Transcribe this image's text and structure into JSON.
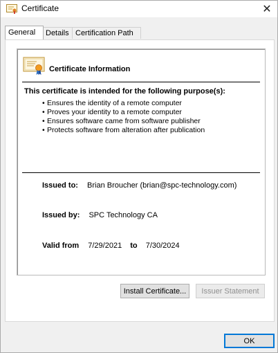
{
  "window": {
    "title": "Certificate",
    "close_glyph": "✕"
  },
  "tabs": [
    {
      "label": "General",
      "active": true
    },
    {
      "label": "Details",
      "active": false
    },
    {
      "label": "Certification Path",
      "active": false
    }
  ],
  "info": {
    "title": "Certificate Information",
    "purpose_heading": "This certificate is intended for the following purpose(s):",
    "purposes": [
      "Ensures the identity of a remote computer",
      "Proves your identity to a remote computer",
      "Ensures software came from software publisher",
      "Protects software from alteration after publication"
    ],
    "bullet": "•",
    "issued_to_label": "Issued to:",
    "issued_to_value": "Brian Broucher (brian@spc-technology.com)",
    "issued_by_label": "Issued by:",
    "issued_by_value": "SPC Technology CA",
    "valid_from_label": "Valid from",
    "valid_from_value": "7/29/2021",
    "valid_to_label": "to",
    "valid_to_value": "7/30/2024"
  },
  "buttons": {
    "install": "Install Certificate...",
    "issuer": "Issuer Statement",
    "ok": "OK"
  },
  "icons": {
    "title_icon": "certificate-icon",
    "info_icon": "certificate-ribbon-icon"
  },
  "colors": {
    "accent": "#0078d7",
    "disabled_text": "#8f8f8f"
  }
}
